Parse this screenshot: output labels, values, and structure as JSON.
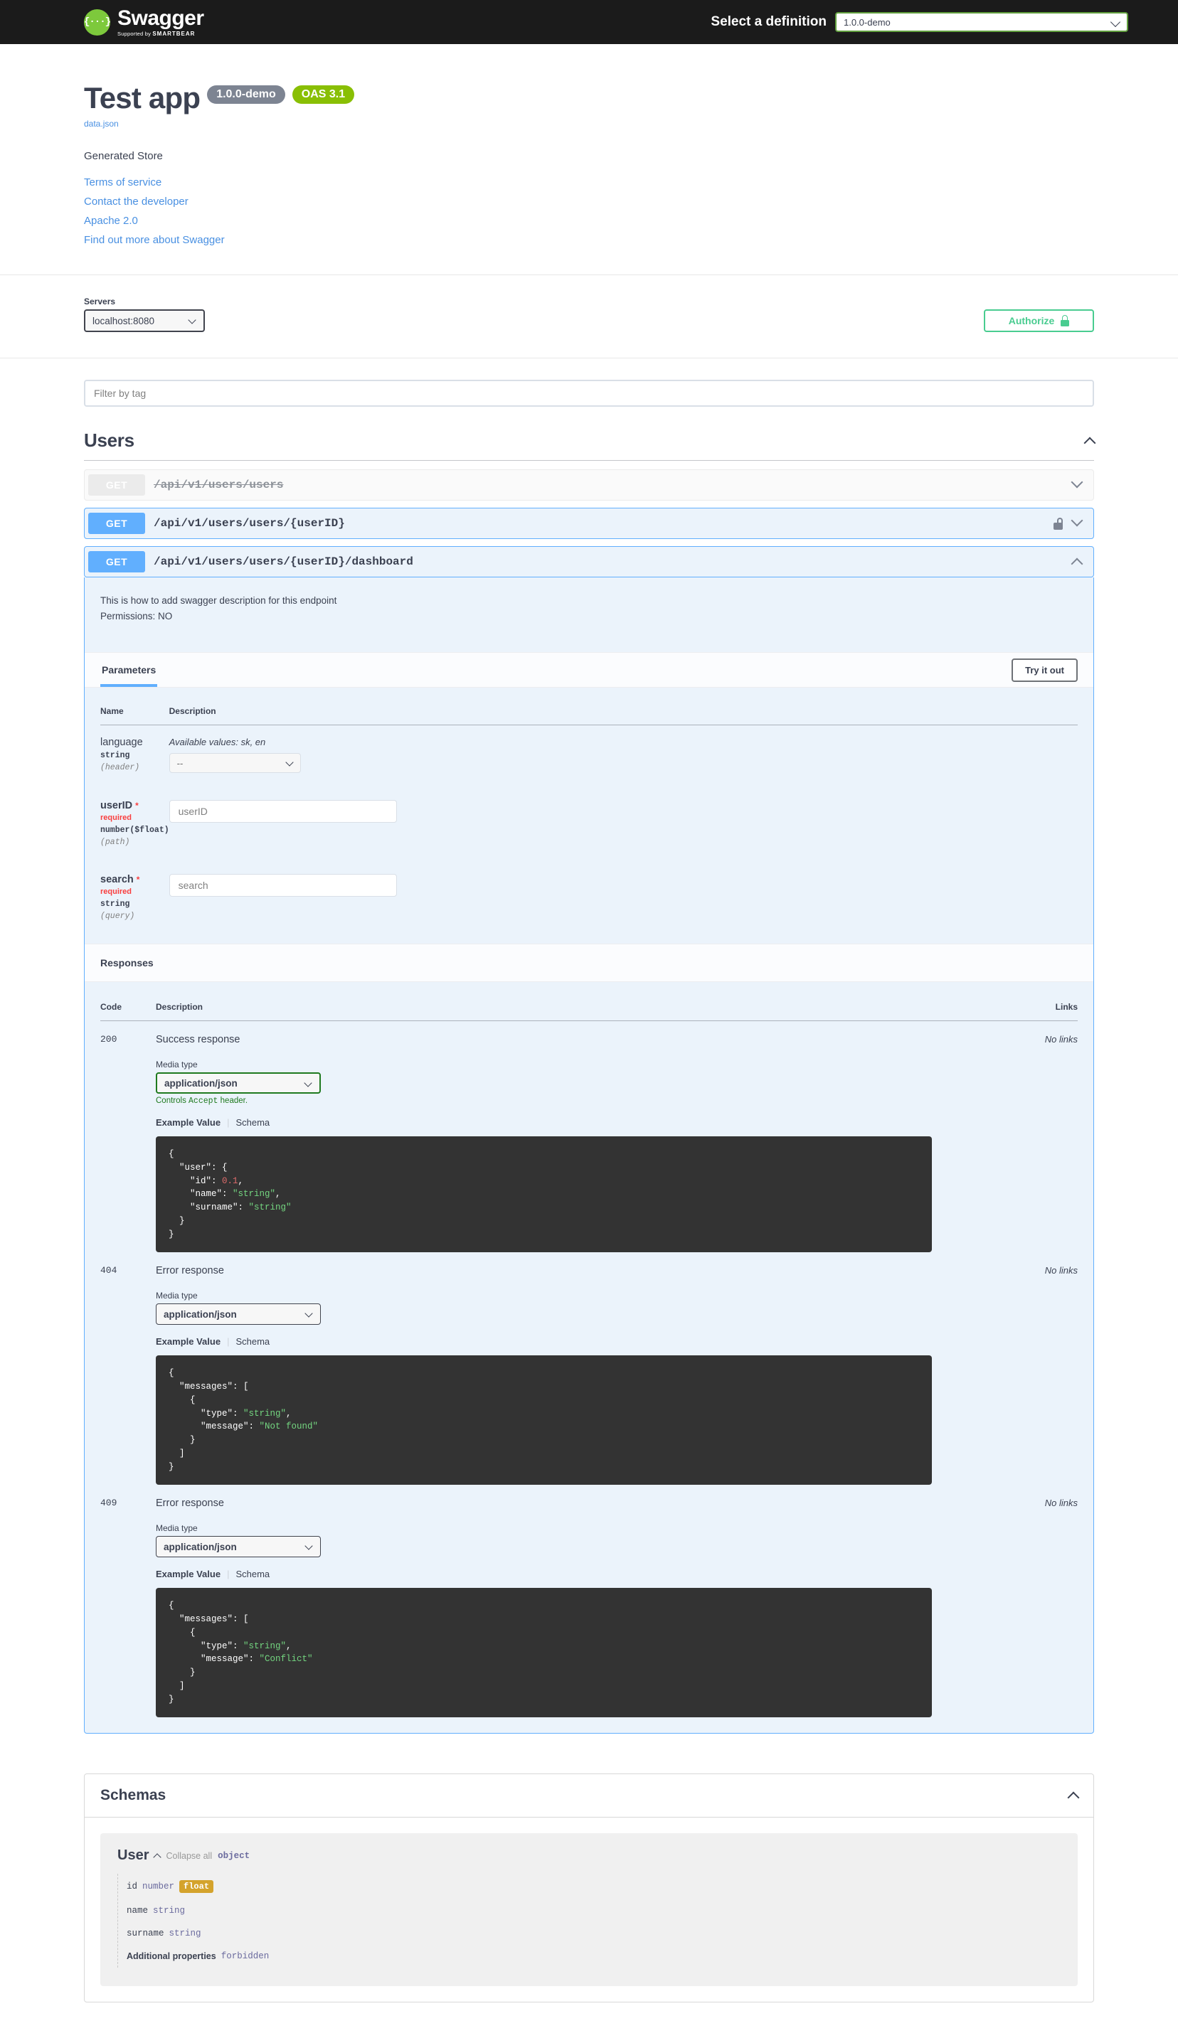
{
  "topbar": {
    "logo_text": "Swagger",
    "logo_supported_prefix": "Supported by",
    "logo_supported_brand": "SMARTBEAR",
    "logo_glyph": "{···}",
    "select_definition_label": "Select a definition",
    "definition_value": "1.0.0-demo"
  },
  "info": {
    "title": "Test app",
    "version_badge": "1.0.0-demo",
    "oas_badge": "OAS 3.1",
    "url": "data.json",
    "description": "Generated Store",
    "links": [
      "Terms of service",
      "Contact the developer",
      "Apache 2.0",
      "Find out more about Swagger"
    ]
  },
  "scheme": {
    "servers_label": "Servers",
    "server_value": "localhost:8080",
    "authorize_label": "Authorize"
  },
  "filter": {
    "placeholder": "Filter by tag",
    "value": ""
  },
  "tag": {
    "name": "Users"
  },
  "operations": [
    {
      "method": "GET",
      "path": "/api/v1/users/users",
      "deprecated": true,
      "locked": false,
      "expanded": false
    },
    {
      "method": "GET",
      "path": "/api/v1/users/users/{userID}",
      "deprecated": false,
      "locked": true,
      "expanded": false
    },
    {
      "method": "GET",
      "path": "/api/v1/users/users/{userID}/dashboard",
      "deprecated": false,
      "locked": false,
      "expanded": true
    }
  ],
  "expanded_op": {
    "description_line1": "This is how to add swagger description for this endpoint",
    "description_line2": "Permissions: NO",
    "tab_parameters": "Parameters",
    "try_it_out": "Try it out",
    "params_header": {
      "name": "Name",
      "description": "Description"
    },
    "parameters": [
      {
        "name": "language",
        "required": false,
        "type": "string",
        "in": "(header)",
        "available_label": "Available values",
        "available_values": ": sk, en",
        "control": "select",
        "select_value": "--"
      },
      {
        "name": "userID",
        "required": true,
        "required_word": "required",
        "type": "number($float)",
        "in": "(path)",
        "control": "input",
        "placeholder": "userID",
        "value": ""
      },
      {
        "name": "search",
        "required": true,
        "required_word": "required",
        "type": "string",
        "in": "(query)",
        "control": "input",
        "placeholder": "search",
        "value": ""
      }
    ],
    "responses_title": "Responses",
    "responses_header": {
      "code": "Code",
      "description": "Description",
      "links": "Links"
    },
    "media_type_label": "Media type",
    "controls_accept_prefix": "Controls ",
    "controls_accept_mono": "Accept",
    "controls_accept_suffix": " header.",
    "example_value_tab": "Example Value",
    "schema_tab": "Schema",
    "no_links": "No links",
    "responses": [
      {
        "code": "200",
        "description": "Success response",
        "media_type": "application/json",
        "media_accent": true,
        "show_controls_note": true,
        "example": "{\n  \"user\": {\n    \"id\": 0.1,\n    \"name\": \"string\",\n    \"surname\": \"string\"\n  }\n}"
      },
      {
        "code": "404",
        "description": "Error response",
        "media_type": "application/json",
        "media_accent": false,
        "show_controls_note": false,
        "example": "{\n  \"messages\": [\n    {\n      \"type\": \"string\",\n      \"message\": \"Not found\"\n    }\n  ]\n}"
      },
      {
        "code": "409",
        "description": "Error response",
        "media_type": "application/json",
        "media_accent": false,
        "show_controls_note": false,
        "example": "{\n  \"messages\": [\n    {\n      \"type\": \"string\",\n      \"message\": \"Conflict\"\n    }\n  ]\n}"
      }
    ]
  },
  "schemas": {
    "title": "Schemas",
    "model_name": "User",
    "collapse_all": "Collapse all",
    "model_type": "object",
    "properties": [
      {
        "name": "id",
        "type": "number",
        "format": "float"
      },
      {
        "name": "name",
        "type": "string",
        "format": ""
      },
      {
        "name": "surname",
        "type": "string",
        "format": ""
      },
      {
        "name": "Additional properties",
        "type": "forbidden",
        "format": "",
        "bold": true
      }
    ]
  },
  "colors": {
    "get": "#61affe",
    "swagger_green": "#7dc93c",
    "oas_green": "#89bf04",
    "authorize_green": "#49cc90",
    "required_red": "#f93e3e",
    "link_blue": "#4990e2",
    "code_bg": "#333333",
    "float_badge": "#d4a32c"
  }
}
